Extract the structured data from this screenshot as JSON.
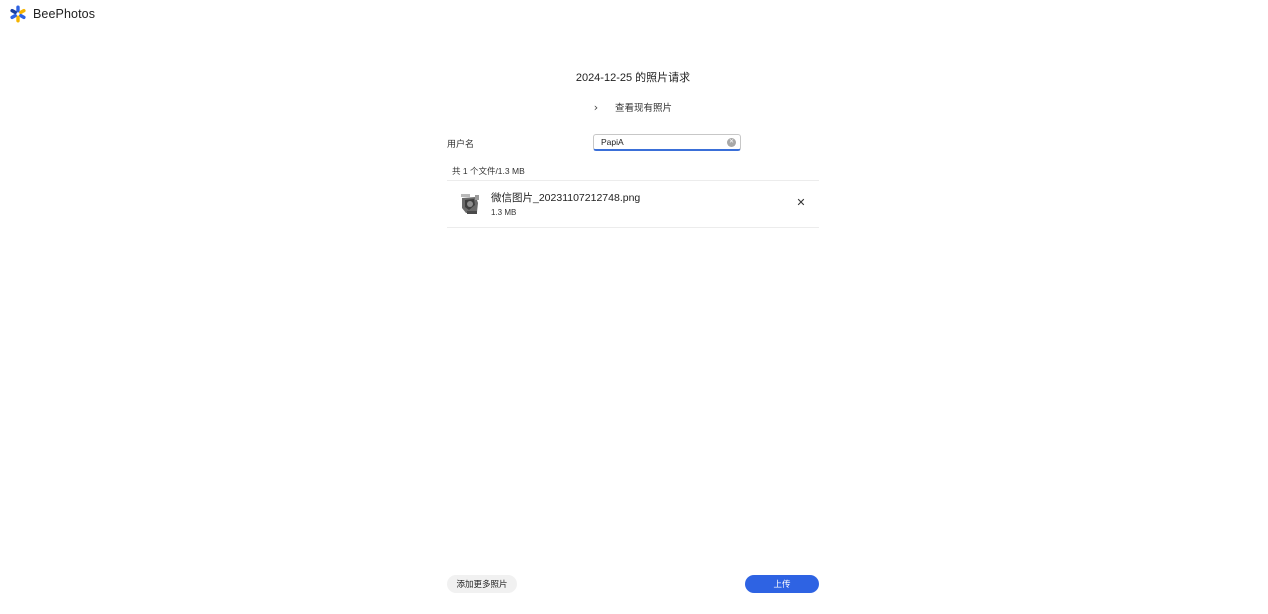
{
  "app": {
    "name": "BeePhotos",
    "logo_icon": "beephotos-logo-icon",
    "brand_colors": [
      "#2e63e3",
      "#f5b400"
    ]
  },
  "request": {
    "title": "2024-12-25 的照片请求",
    "view_existing_label": "查看现有照片",
    "view_existing_icon": "chevron-right-icon"
  },
  "form": {
    "username_label": "用户名",
    "username_value": "PapiA",
    "username_placeholder": "",
    "clear_icon": "clear-icon"
  },
  "files": {
    "summary": "共 1 个文件/1.3 MB",
    "items": [
      {
        "name": "微信图片_20231107212748.png",
        "size": "1.3 MB",
        "thumb_icon": "image-thumbnail",
        "remove_icon": "close-icon"
      }
    ]
  },
  "actions": {
    "add_more_label": "添加更多照片",
    "upload_label": "上传",
    "upload_color": "#2e63e3"
  }
}
